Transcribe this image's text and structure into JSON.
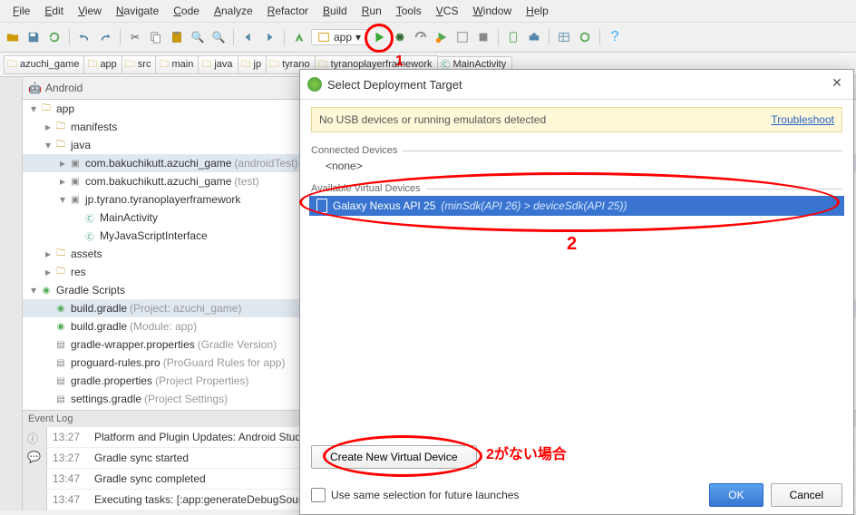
{
  "menu": [
    "File",
    "Edit",
    "View",
    "Navigate",
    "Code",
    "Analyze",
    "Refactor",
    "Build",
    "Run",
    "Tools",
    "VCS",
    "Window",
    "Help"
  ],
  "config_label": "app",
  "anno": {
    "one": "1",
    "two": "2",
    "btn": "2がない場合"
  },
  "breadcrumbs": [
    {
      "icon": "folder",
      "label": "azuchi_game"
    },
    {
      "icon": "folder",
      "label": "app"
    },
    {
      "icon": "folder",
      "label": "src"
    },
    {
      "icon": "folder",
      "label": "main"
    },
    {
      "icon": "folder",
      "label": "java"
    },
    {
      "icon": "folder",
      "label": "jp"
    },
    {
      "icon": "folder",
      "label": "tyrano"
    },
    {
      "icon": "folder",
      "label": "tyranoplayerframework"
    },
    {
      "icon": "class",
      "label": "MainActivity"
    }
  ],
  "panel": {
    "title": "Android",
    "android_icon": "🤖"
  },
  "tree": [
    {
      "d": 0,
      "tw": "▾",
      "ic": "folder",
      "txt": "app"
    },
    {
      "d": 1,
      "tw": "▸",
      "ic": "folder",
      "txt": "manifests"
    },
    {
      "d": 1,
      "tw": "▾",
      "ic": "folder",
      "txt": "java"
    },
    {
      "d": 2,
      "tw": "▸",
      "ic": "pkg",
      "txt": "com.bakuchikutt.azuchi_game",
      "suf": "(androidTest)",
      "sel": true
    },
    {
      "d": 2,
      "tw": "▸",
      "ic": "pkg",
      "txt": "com.bakuchikutt.azuchi_game",
      "suf": "(test)"
    },
    {
      "d": 2,
      "tw": "▾",
      "ic": "pkg",
      "txt": "jp.tyrano.tyranoplayerframework"
    },
    {
      "d": 3,
      "tw": "",
      "ic": "cls",
      "txt": "MainActivity"
    },
    {
      "d": 3,
      "tw": "",
      "ic": "cls",
      "txt": "MyJavaScriptInterface"
    },
    {
      "d": 1,
      "tw": "▸",
      "ic": "folder",
      "txt": "assets"
    },
    {
      "d": 1,
      "tw": "▸",
      "ic": "folder",
      "txt": "res"
    },
    {
      "d": 0,
      "tw": "▾",
      "ic": "grd",
      "txt": "Gradle Scripts"
    },
    {
      "d": 1,
      "tw": "",
      "ic": "grd",
      "txt": "build.gradle",
      "suf": "(Project: azuchi_game)",
      "sel": true
    },
    {
      "d": 1,
      "tw": "",
      "ic": "grd",
      "txt": "build.gradle",
      "suf": "(Module: app)"
    },
    {
      "d": 1,
      "tw": "",
      "ic": "file",
      "txt": "gradle-wrapper.properties",
      "suf": "(Gradle Version)"
    },
    {
      "d": 1,
      "tw": "",
      "ic": "file",
      "txt": "proguard-rules.pro",
      "suf": "(ProGuard Rules for app)"
    },
    {
      "d": 1,
      "tw": "",
      "ic": "file",
      "txt": "gradle.properties",
      "suf": "(Project Properties)"
    },
    {
      "d": 1,
      "tw": "",
      "ic": "file",
      "txt": "settings.gradle",
      "suf": "(Project Settings)"
    }
  ],
  "log": {
    "title": "Event Log",
    "rows": [
      {
        "time": "13:27",
        "msg": "Platform and Plugin Updates: Android Studio is ..."
      },
      {
        "time": "13:27",
        "msg": "Gradle sync started"
      },
      {
        "time": "13:47",
        "msg": "Gradle sync completed"
      },
      {
        "time": "13:47",
        "msg": "Executing tasks: [:app:generateDebugSources, ..."
      }
    ]
  },
  "dialog": {
    "title": "Select Deployment Target",
    "warning": "No USB devices or running emulators detected",
    "troubleshoot": "Troubleshoot",
    "sect_connected": "Connected Devices",
    "none": "<none>",
    "sect_available": "Available Virtual Devices",
    "device_name": "Galaxy Nexus API 25",
    "device_suf": "(minSdk(API 26) > deviceSdk(API 25))",
    "create_btn": "Create New Virtual Device",
    "checkbox": "Use same selection for future launches",
    "ok": "OK",
    "cancel": "Cancel"
  }
}
